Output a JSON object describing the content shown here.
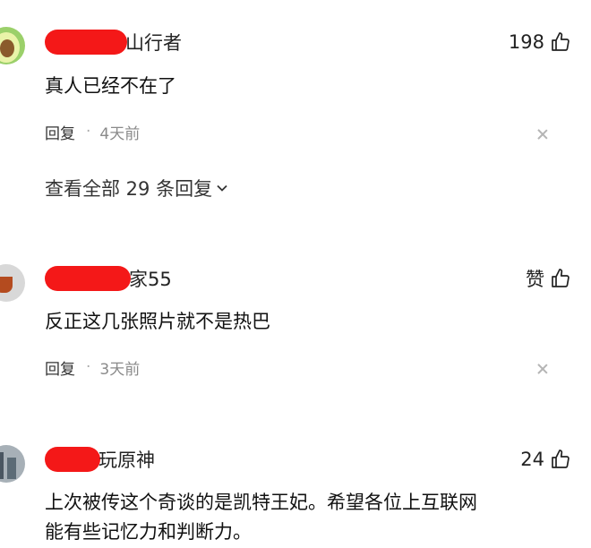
{
  "comments": [
    {
      "username": "山行者",
      "likes": "198",
      "text": "真人已经不在了",
      "reply_label": "回复",
      "time": "4天前",
      "view_all": "查看全部 29 条回复"
    },
    {
      "username": "家55",
      "likes": "赞",
      "text": "反正这几张照片就不是热巴",
      "reply_label": "回复",
      "time": "3天前"
    },
    {
      "username": "玩原神",
      "likes": "24",
      "text_line1": "上次被传这个奇谈的是凯特王妃。希望各位上互联网",
      "text_line2": "能有些记忆力和判断力。"
    }
  ],
  "colors": {
    "redaction": "#f41818",
    "meta_gray": "#8a8a8a"
  },
  "icons": [
    "thumbs-up-icon",
    "close-icon",
    "chevron-down-icon"
  ]
}
